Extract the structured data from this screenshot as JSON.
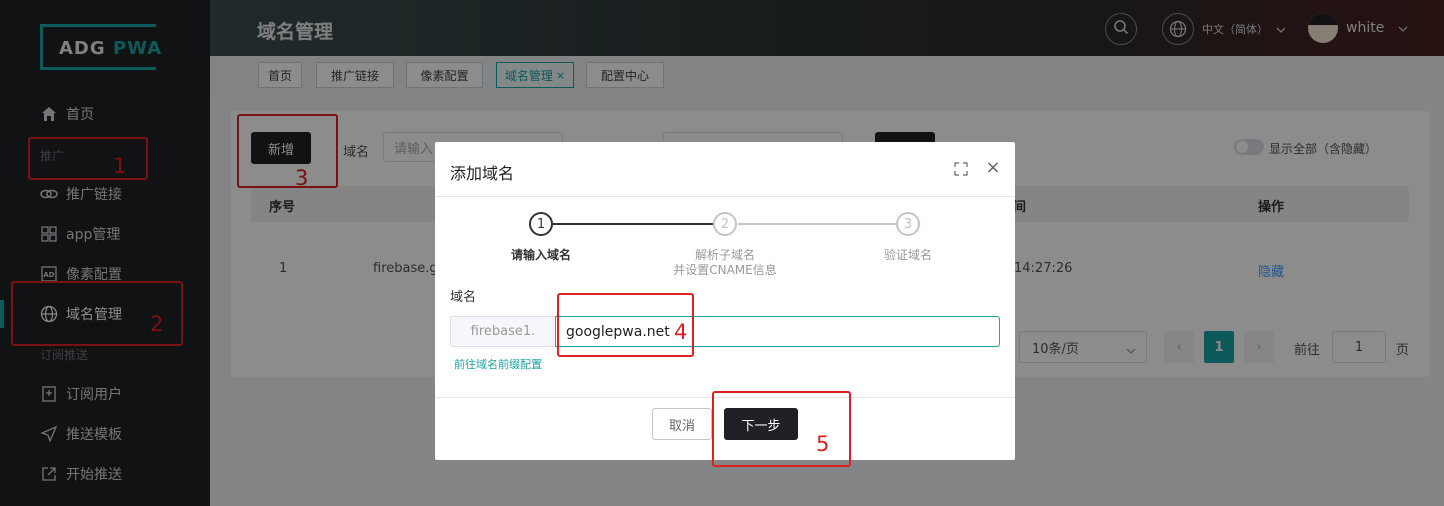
{
  "sidebar": {
    "logo_prefix": "ADG",
    "logo_suffix": "PWA",
    "items": [
      {
        "label": "首页",
        "icon": "home-icon"
      },
      {
        "label": "推广链接",
        "icon": "link-icon"
      },
      {
        "label": "app管理",
        "icon": "grid-icon"
      },
      {
        "label": "像素配置",
        "icon": "ad-icon"
      },
      {
        "label": "域名管理",
        "icon": "globe-icon"
      },
      {
        "label": "订阅用户",
        "icon": "subscribe-icon"
      },
      {
        "label": "推送模板",
        "icon": "send-icon"
      },
      {
        "label": "开始推送",
        "icon": "external-icon"
      }
    ],
    "sections": [
      "推广",
      "订阅推送"
    ]
  },
  "header": {
    "title": "域名管理",
    "language": "中文（简体）",
    "username": "white"
  },
  "tabs": [
    {
      "label": "首页"
    },
    {
      "label": "推广链接"
    },
    {
      "label": "像素配置"
    },
    {
      "label": "域名管理",
      "active": true
    },
    {
      "label": "配置中心"
    }
  ],
  "toolbar": {
    "add_label": "新增",
    "domain_filter_label": "域名",
    "domain_filter_placeholder": "请输入",
    "show_all_label": "显示全部（含隐藏）"
  },
  "table": {
    "columns": [
      "序号",
      "间",
      "操作"
    ],
    "rows": [
      {
        "index": "1",
        "domain": "firebase.g",
        "time": "14:27:26",
        "action": "隐藏"
      }
    ]
  },
  "pagination": {
    "page_size": "10条/页",
    "current": "1",
    "goto_label": "前往",
    "goto_value": "1",
    "page_suffix": "页"
  },
  "modal": {
    "title": "添加域名",
    "steps": [
      {
        "num": "1",
        "label": "请输入域名"
      },
      {
        "num": "2",
        "label": "解析子域名",
        "label2": "并设置CNAME信息"
      },
      {
        "num": "3",
        "label": "验证域名"
      }
    ],
    "field_label": "域名",
    "prefix": "firebase1.",
    "value": "googlepwa.net",
    "hint_link": "前往域名前缀配置",
    "cancel_label": "取消",
    "next_label": "下一步"
  },
  "annotations": [
    "1",
    "2",
    "3",
    "4",
    "5"
  ],
  "colors": {
    "accent": "#1aa3a3",
    "sidebar_bg": "#1f2126",
    "annotation": "#e02020"
  }
}
